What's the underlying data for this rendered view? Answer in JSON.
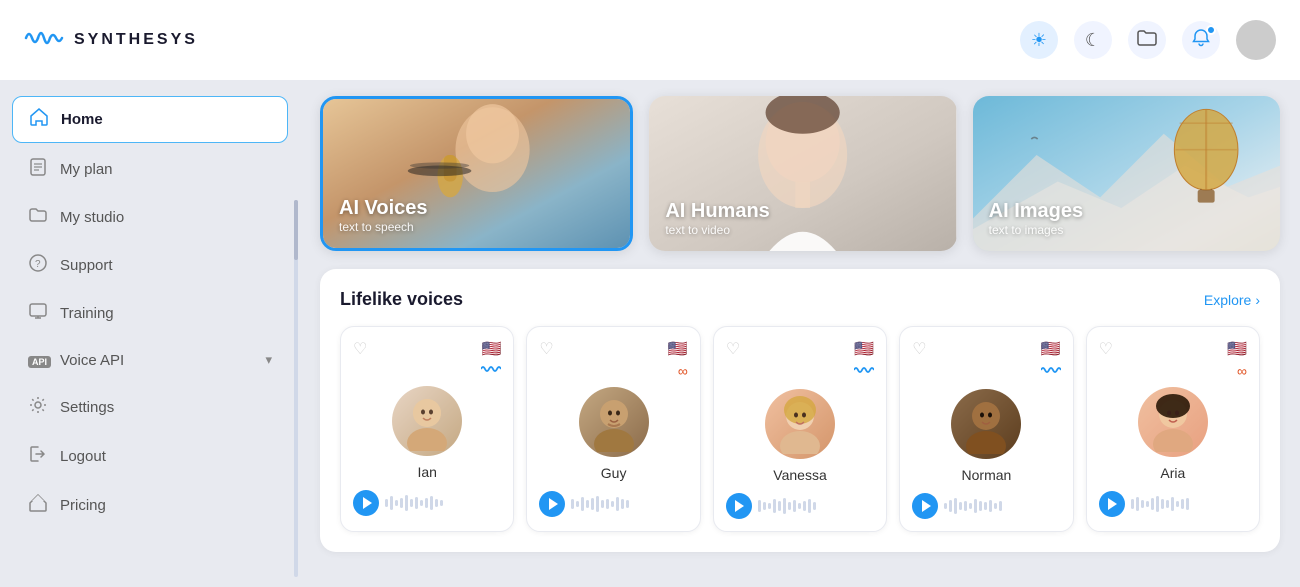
{
  "app": {
    "title": "SYNTHESYS"
  },
  "header": {
    "logo_alt": "Synthesys logo",
    "icons": {
      "theme_light": "☀",
      "theme_dark": "☾",
      "folder": "📁",
      "notifications": "🔔"
    }
  },
  "sidebar": {
    "items": [
      {
        "id": "home",
        "label": "Home",
        "icon": "🏠",
        "active": true
      },
      {
        "id": "my-plan",
        "label": "My plan",
        "icon": "📄",
        "active": false
      },
      {
        "id": "my-studio",
        "label": "My studio",
        "icon": "📁",
        "active": false
      },
      {
        "id": "support",
        "label": "Support",
        "icon": "❓",
        "active": false
      },
      {
        "id": "training",
        "label": "Training",
        "icon": "🖥",
        "active": false
      },
      {
        "id": "voice-api",
        "label": "Voice API",
        "icon": "API",
        "active": false,
        "has_arrow": true
      },
      {
        "id": "settings",
        "label": "Settings",
        "icon": "⚙",
        "active": false
      },
      {
        "id": "logout",
        "label": "Logout",
        "icon": "→",
        "active": false
      },
      {
        "id": "pricing",
        "label": "Pricing",
        "icon": "🏷",
        "active": false
      }
    ]
  },
  "categories": [
    {
      "id": "ai-voices",
      "title": "AI Voices",
      "subtitle": "text to speech",
      "selected": true,
      "bg_type": "voices"
    },
    {
      "id": "ai-humans",
      "title": "AI Humans",
      "subtitle": "text to video",
      "selected": false,
      "bg_type": "humans"
    },
    {
      "id": "ai-images",
      "title": "AI Images",
      "subtitle": "text to images",
      "selected": false,
      "bg_type": "images"
    }
  ],
  "voices_section": {
    "title": "Lifelike voices",
    "explore_label": "Explore",
    "explore_arrow": "›",
    "voices": [
      {
        "id": "ian",
        "name": "Ian",
        "flag": "🇺🇸",
        "liked": false,
        "status": "wave",
        "emoji": "👨"
      },
      {
        "id": "guy",
        "name": "Guy",
        "flag": "🇺🇸",
        "liked": false,
        "status": "audio",
        "emoji": "👨"
      },
      {
        "id": "vanessa",
        "name": "Vanessa",
        "flag": "🇺🇸",
        "liked": false,
        "status": "wave",
        "emoji": "👩"
      },
      {
        "id": "norman",
        "name": "Norman",
        "flag": "🇺🇸",
        "liked": false,
        "status": "wave",
        "emoji": "👨"
      },
      {
        "id": "aria",
        "name": "Aria",
        "flag": "🇺🇸",
        "liked": false,
        "status": "audio",
        "emoji": "👩"
      }
    ]
  }
}
